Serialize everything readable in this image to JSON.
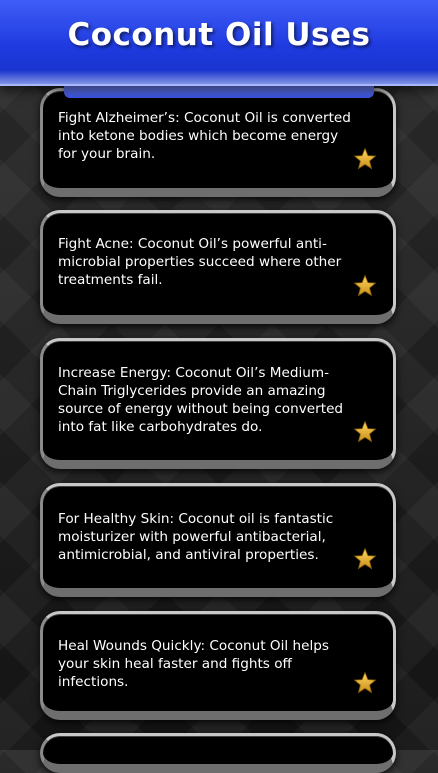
{
  "header": {
    "title": "Coconut Oil Uses"
  },
  "items": [
    {
      "text": "Fight Alzheimer’s: Coconut Oil is converted into ketone bodies which become energy for your brain.",
      "icon": "star-icon"
    },
    {
      "text": "Fight Acne: Coconut Oil’s powerful anti-microbial properties succeed where other treatments fail.",
      "icon": "star-icon"
    },
    {
      "text": "Increase Energy: Coconut Oil’s Medium-Chain Triglycerides provide an amazing source of energy without being converted into fat like carbohydrates do.",
      "icon": "star-icon"
    },
    {
      "text": "For Healthy Skin: Coconut oil is fantastic moisturizer with powerful antibacterial, antimicrobial, and antiviral properties.",
      "icon": "star-icon"
    },
    {
      "text": "Heal Wounds Quickly: Coconut Oil helps your skin heal faster and fights off infections.",
      "icon": "star-icon"
    }
  ],
  "colors": {
    "header": "#1f3be0",
    "card": "#000000",
    "star": "#e8b631"
  }
}
